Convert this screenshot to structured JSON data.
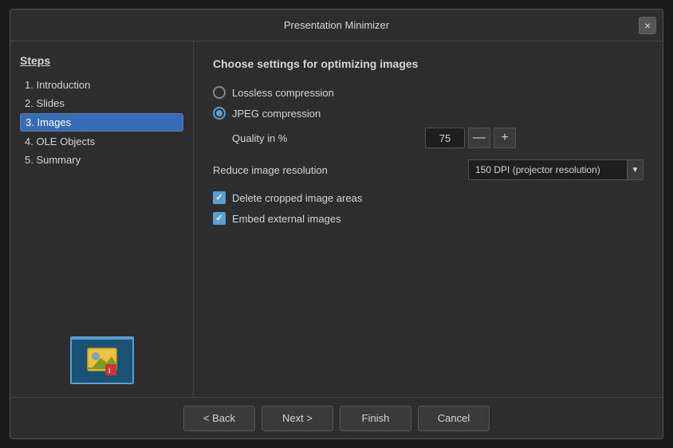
{
  "dialog": {
    "title": "Presentation Minimizer",
    "close_label": "×"
  },
  "sidebar": {
    "heading": "Steps",
    "items": [
      {
        "id": "introduction",
        "label": "1. Introduction",
        "active": false
      },
      {
        "id": "slides",
        "label": "2. Slides",
        "active": false
      },
      {
        "id": "images",
        "label": "3. Images",
        "active": true
      },
      {
        "id": "ole-objects",
        "label": "4. OLE Objects",
        "active": false
      },
      {
        "id": "summary",
        "label": "5. Summary",
        "active": false
      }
    ]
  },
  "main": {
    "section_title": "Choose settings for optimizing images",
    "lossless_label": "Lossless compression",
    "jpeg_label": "JPEG compression",
    "quality_label": "Quality in %",
    "quality_value": "75",
    "reduce_label": "Reduce image resolution",
    "dpi_value": "150 DPI (projector resolution)",
    "delete_cropped_label": "Delete cropped image areas",
    "embed_external_label": "Embed external images"
  },
  "footer": {
    "back_label": "< Back",
    "next_label": "Next >",
    "finish_label": "Finish",
    "cancel_label": "Cancel"
  },
  "icons": {
    "minus": "—",
    "plus": "+",
    "dropdown_arrow": "▼"
  }
}
